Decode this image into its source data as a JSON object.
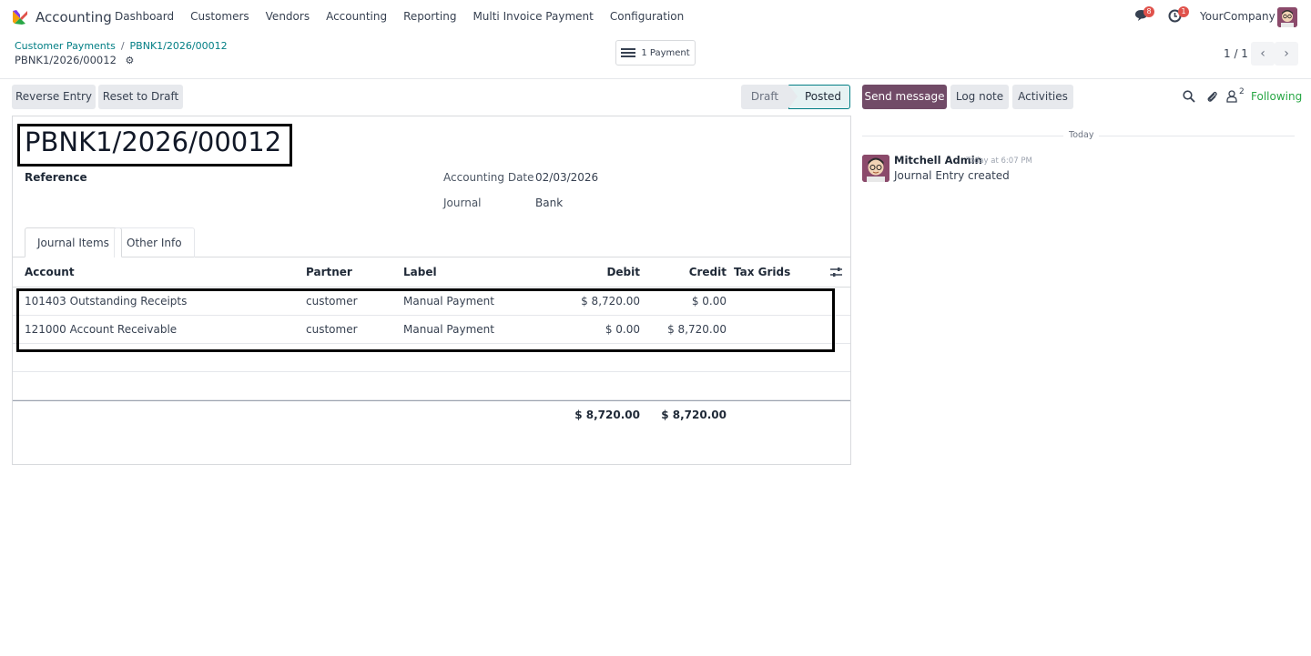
{
  "navbar": {
    "app_name": "Accounting",
    "menu": [
      "Dashboard",
      "Customers",
      "Vendors",
      "Accounting",
      "Reporting",
      "Multi Invoice Payment",
      "Configuration"
    ],
    "messages_badge": "8",
    "activities_badge": "1",
    "company": "YourCompany"
  },
  "breadcrumb": {
    "parent": "Customer Payments",
    "current": "PBNK1/2026/00012"
  },
  "record": {
    "name": "PBNK1/2026/00012"
  },
  "smart_button": {
    "label": "1 Payment"
  },
  "pager": {
    "value": "1 / 1"
  },
  "actions": {
    "reverse": "Reverse Entry",
    "reset": "Reset to Draft"
  },
  "status": {
    "draft": "Draft",
    "posted": "Posted"
  },
  "form": {
    "title": "PBNK1/2026/00012",
    "reference_label": "Reference",
    "date_label": "Accounting Date",
    "date_value": "02/03/2026",
    "journal_label": "Journal",
    "journal_value": "Bank"
  },
  "tabs": [
    "Journal Items",
    "Other Info"
  ],
  "table": {
    "headers": {
      "account": "Account",
      "partner": "Partner",
      "label": "Label",
      "debit": "Debit",
      "credit": "Credit",
      "tax": "Tax Grids"
    },
    "rows": [
      {
        "account": "101403 Outstanding Receipts",
        "partner": "customer",
        "label": "Manual Payment",
        "debit": "$ 8,720.00",
        "credit": "$ 0.00"
      },
      {
        "account": "121000 Account Receivable",
        "partner": "customer",
        "label": "Manual Payment",
        "debit": "$ 0.00",
        "credit": "$ 8,720.00"
      }
    ],
    "totals": {
      "debit": "$ 8,720.00",
      "credit": "$ 8,720.00"
    }
  },
  "chatter": {
    "send_message": "Send message",
    "log_note": "Log note",
    "activities": "Activities",
    "followers_count": "2",
    "following": "Following",
    "day": "Today",
    "message": {
      "author": "Mitchell Admin",
      "time": "Today at 6:07 PM",
      "body": "Journal Entry created"
    }
  }
}
